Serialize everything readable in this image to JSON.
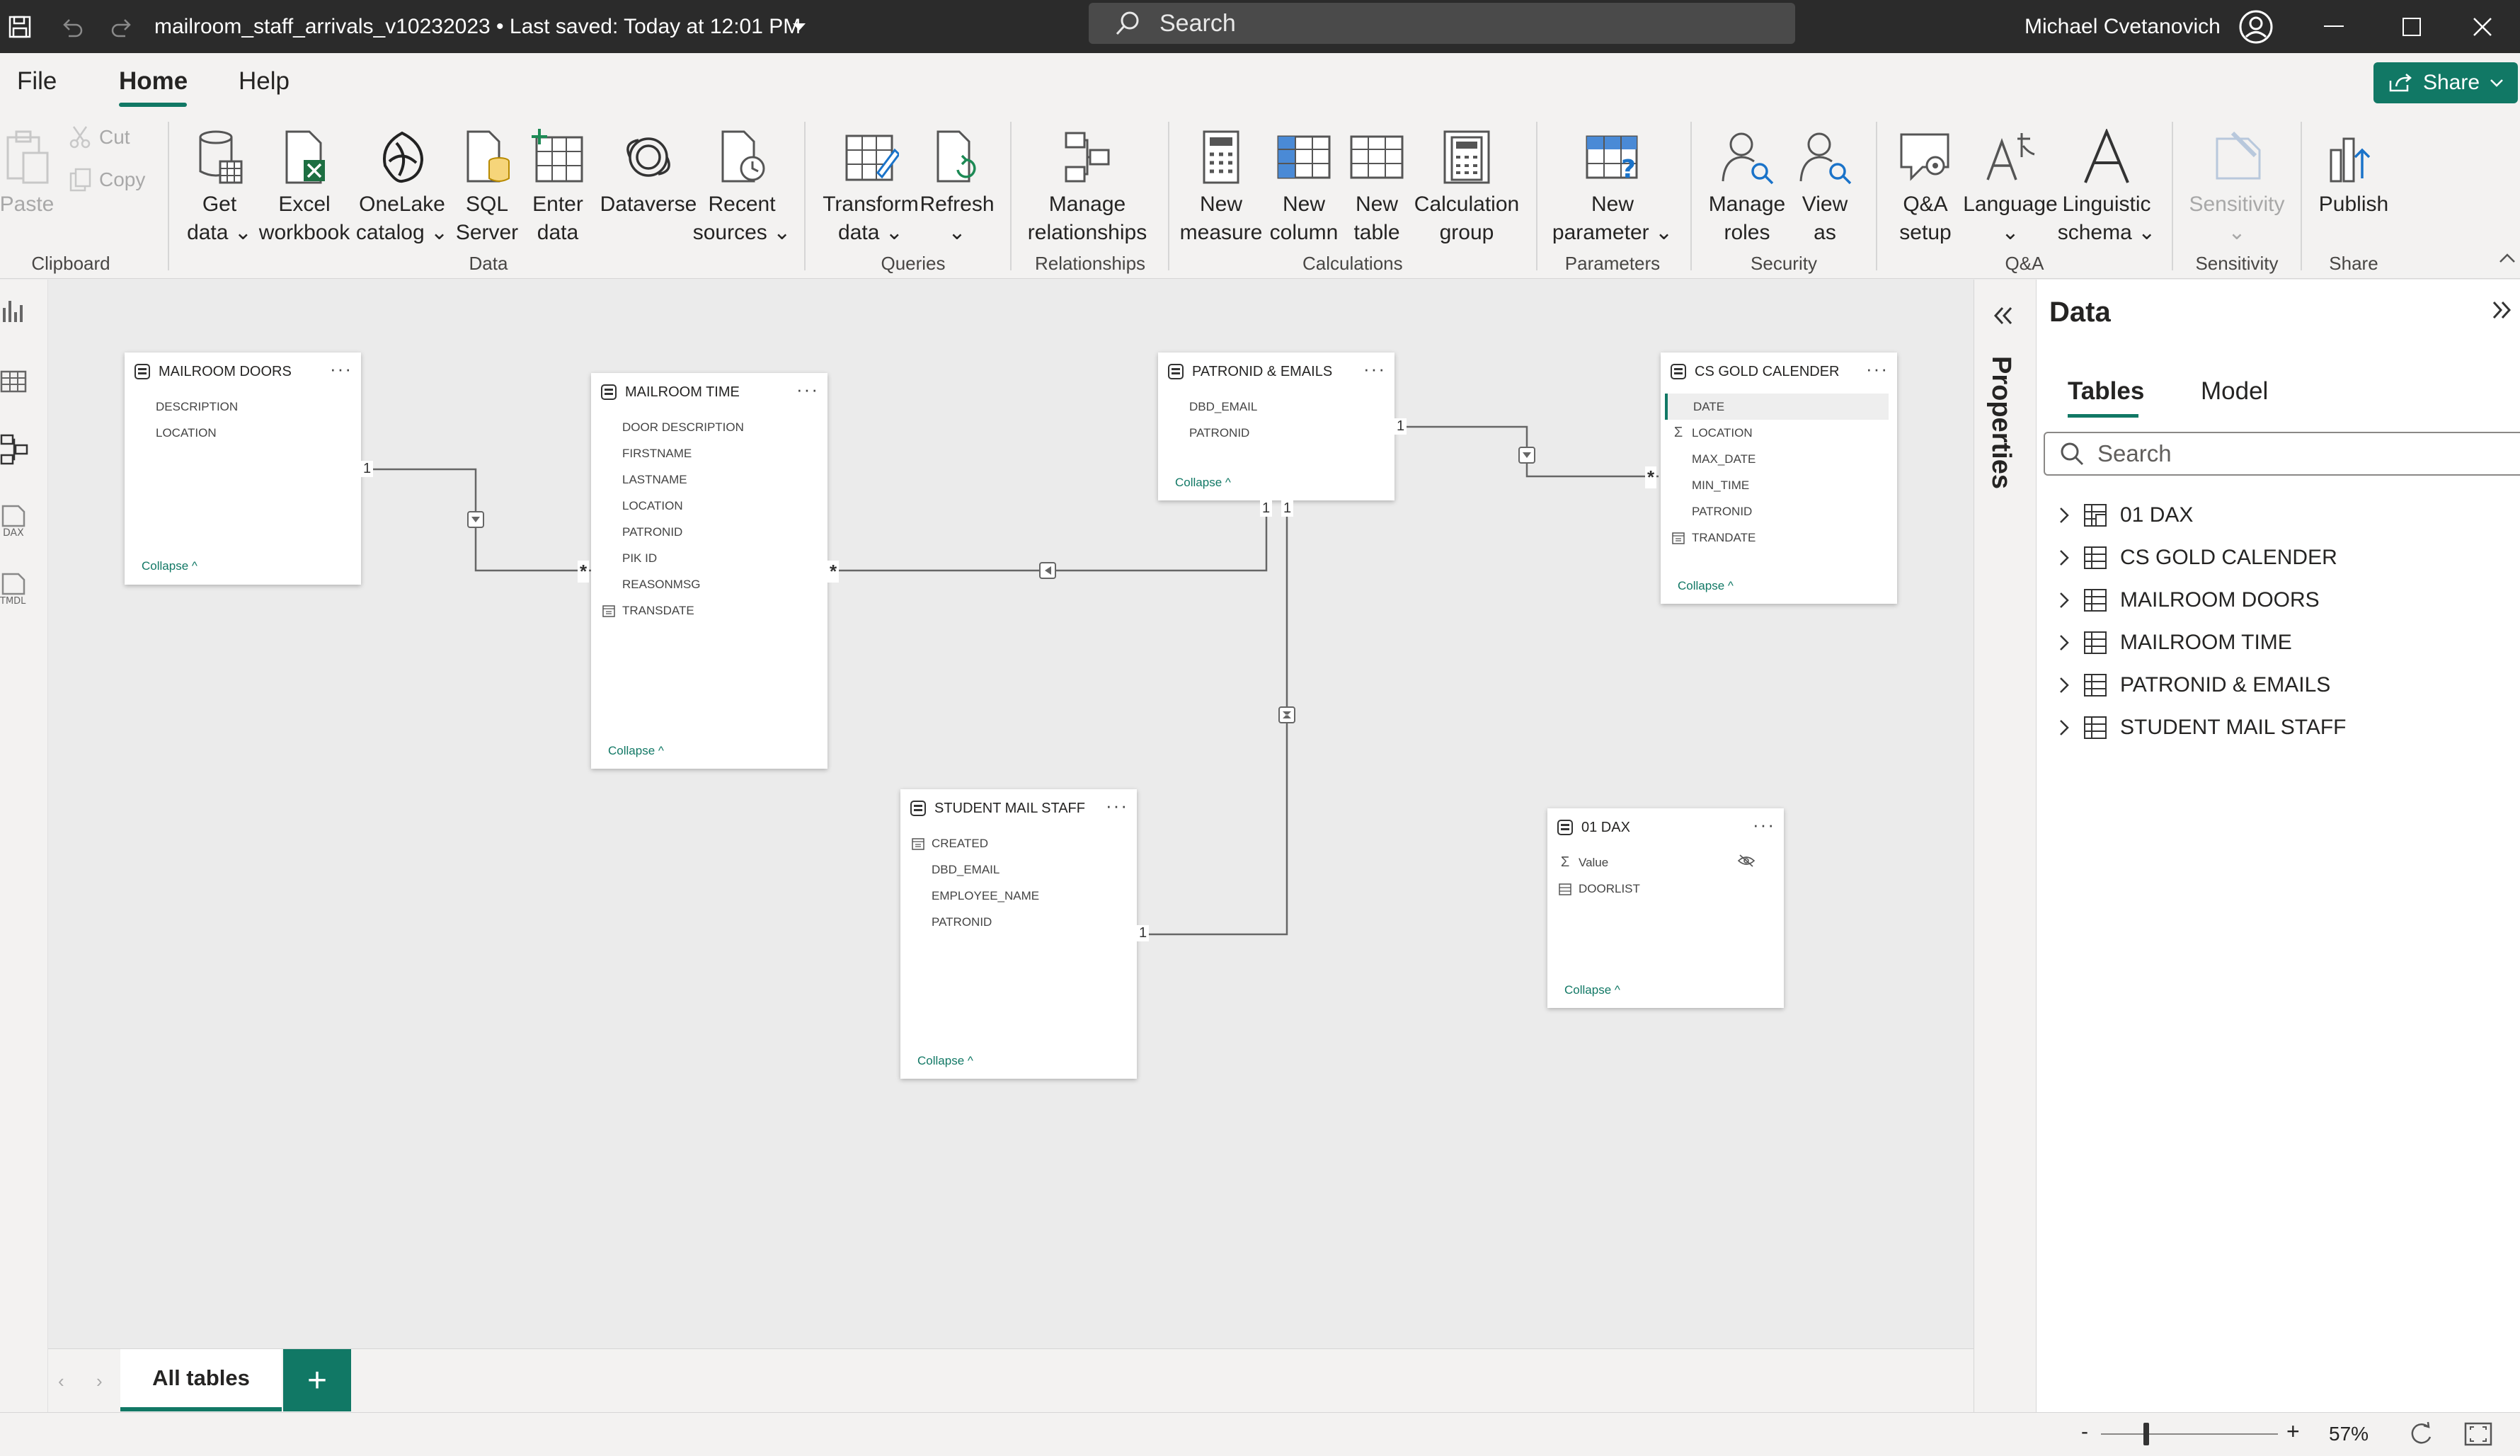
{
  "titlebar": {
    "file_title": "mailroom_staff_arrivals_v10232023 • Last saved: Today at 12:01 PM",
    "search_placeholder": "Search",
    "user_name": "Michael Cvetanovich"
  },
  "menu": {
    "file": "File",
    "home": "Home",
    "help": "Help",
    "share": "Share"
  },
  "ribbon": {
    "clipboard": {
      "paste": "Paste",
      "cut": "Cut",
      "copy": "Copy",
      "group": "Clipboard"
    },
    "data": {
      "get_data": "Get\ndata ⌄",
      "excel": "Excel\nworkbook",
      "onelake": "OneLake\ncatalog ⌄",
      "sql": "SQL\nServer",
      "enter": "Enter\ndata",
      "dataverse": "Dataverse",
      "recent": "Recent\nsources ⌄",
      "group": "Data"
    },
    "queries": {
      "transform": "Transform\ndata ⌄",
      "refresh": "Refresh\n⌄",
      "group": "Queries"
    },
    "relationships": {
      "manage": "Manage\nrelationships",
      "group": "Relationships"
    },
    "calculations": {
      "new_measure": "New\nmeasure",
      "new_column": "New\ncolumn",
      "new_table": "New\ntable",
      "calc_group": "Calculation\ngroup",
      "group": "Calculations"
    },
    "parameters": {
      "new_param": "New\nparameter ⌄",
      "group": "Parameters"
    },
    "security": {
      "manage_roles": "Manage\nroles",
      "view_as": "View\nas",
      "group": "Security"
    },
    "qa": {
      "qa_setup": "Q&A\nsetup",
      "language": "Language\n⌄",
      "linguistic": "Linguistic\nschema ⌄",
      "group": "Q&A"
    },
    "sensitivity": {
      "sensitivity": "Sensitivity\n⌄",
      "group": "Sensitivity"
    },
    "share": {
      "publish": "Publish",
      "group": "Share"
    }
  },
  "tables": {
    "mailroom_doors": {
      "title": "MAILROOM DOORS",
      "fields": [
        "DESCRIPTION",
        "LOCATION"
      ],
      "collapse": "Collapse ^"
    },
    "mailroom_time": {
      "title": "MAILROOM TIME",
      "fields": [
        "DOOR DESCRIPTION",
        "FIRSTNAME",
        "LASTNAME",
        "LOCATION",
        "PATRONID",
        "PIK ID",
        "REASONMSG",
        "TRANSDATE"
      ],
      "collapse": "Collapse ^"
    },
    "patronid_emails": {
      "title": "PATRONID & EMAILS",
      "fields": [
        "DBD_EMAIL",
        "PATRONID"
      ],
      "collapse": "Collapse ^"
    },
    "cs_gold": {
      "title": "CS GOLD CALENDER",
      "fields": [
        "DATE",
        "LOCATION",
        "MAX_DATE",
        "MIN_TIME",
        "PATRONID",
        "TRANDATE"
      ],
      "collapse": "Collapse ^"
    },
    "student_staff": {
      "title": "STUDENT MAIL STAFF",
      "fields": [
        "CREATED",
        "DBD_EMAIL",
        "EMPLOYEE_NAME",
        "PATRONID"
      ],
      "collapse": "Collapse ^"
    },
    "dax": {
      "title": "01 DAX",
      "fields": [
        "Value",
        "DOORLIST"
      ],
      "collapse": "Collapse ^"
    }
  },
  "cardinality": {
    "one": "1",
    "many": "*"
  },
  "pages": {
    "all_tables": "All tables",
    "add": "+"
  },
  "status": {
    "zoom": "57%"
  },
  "properties": {
    "label": "Properties"
  },
  "data_pane": {
    "title": "Data",
    "tab_tables": "Tables",
    "tab_model": "Model",
    "search_placeholder": "Search",
    "items": [
      "01 DAX",
      "CS GOLD CALENDER",
      "MAILROOM DOORS",
      "MAILROOM TIME",
      "PATRONID & EMAILS",
      "STUDENT MAIL STAFF"
    ]
  }
}
